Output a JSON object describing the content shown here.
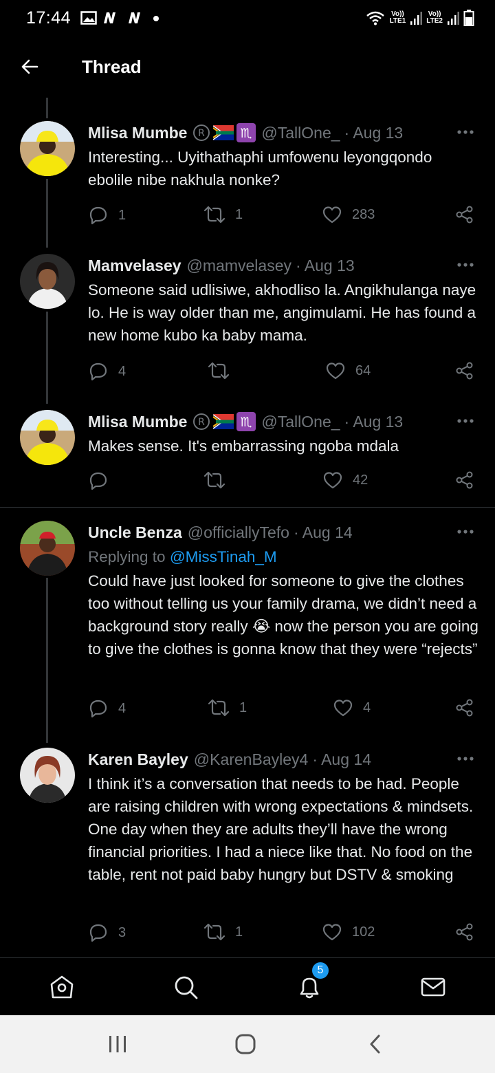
{
  "status_bar": {
    "time": "17:44",
    "lte1": "LTE1",
    "lte2": "LTE2",
    "vol1": "Vo))",
    "vol2": "Vo))"
  },
  "header": {
    "title": "Thread"
  },
  "tweets": [
    {
      "name": "Mlisa Mumbe",
      "handle": "@TallOne_",
      "date": "· Aug 13",
      "text": "Interesting... Uyithathaphi umfowenu leyongqondo ebolile nibe nakhula nonke?",
      "replies": "1",
      "retweets": "1",
      "likes": "283"
    },
    {
      "name": "Mamvelasey",
      "handle": "@mamvelasey",
      "date": "· Aug 13",
      "text": "Someone said udlisiwe, akhodliso la. Angikhulanga naye lo. He is way older than me, angimulami. He has found a new home kubo ka baby mama.",
      "replies": "4",
      "retweets": "",
      "likes": "64"
    },
    {
      "name": "Mlisa Mumbe",
      "handle": "@TallOne_",
      "date": "· Aug 13",
      "text": "Makes sense. It's embarrassing ngoba mdala",
      "replies": "",
      "retweets": "",
      "likes": "42"
    },
    {
      "name": "Uncle Benza",
      "handle": "@officiallyTefo",
      "date": "· Aug 14",
      "replying_prefix": "Replying to ",
      "replying_mention": "@MissTinah_M",
      "text": "Could have just looked for someone to give the clothes too without telling us your family drama, we didn’t need a background story really 😭 now the person you are going to give the clothes is gonna know that they were “rejects”",
      "replies": "4",
      "retweets": "1",
      "likes": "4"
    },
    {
      "name": "Karen Bayley",
      "handle": "@KarenBayley4",
      "date": "· Aug 14",
      "text": "I think it’s a conversation that needs to be had. People are raising children with wrong expectations & mindsets. One day when they are adults they’ll have the wrong financial priorities. I had a niece like that. No food on the table, rent not paid baby hungry but DSTV & smoking",
      "replies": "3",
      "retweets": "1",
      "likes": "102"
    }
  ],
  "badges": {
    "registered": "R",
    "scorpio": "♏"
  },
  "bottom_nav": {
    "notifications_count": "5"
  },
  "colors": {
    "accent": "#1d9bf0",
    "muted": "#71767b",
    "text": "#e7e9ea",
    "background": "#000000"
  }
}
